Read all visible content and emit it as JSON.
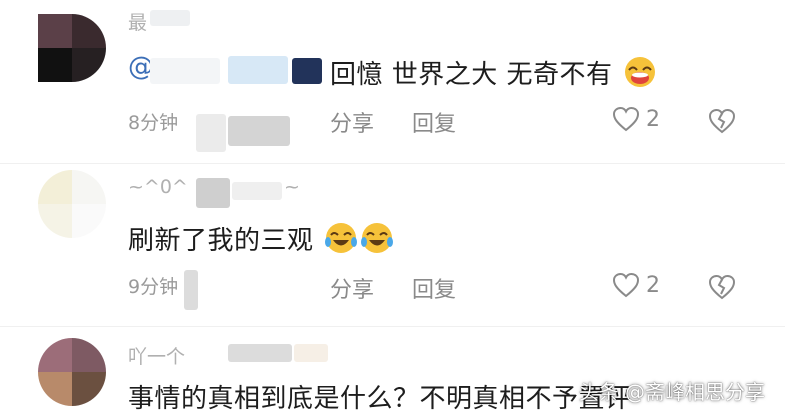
{
  "comments": [
    {
      "username": "最",
      "mention": "@",
      "text": "回憶 世界之大 无奇不有",
      "time": "8分钟",
      "share_label": "分享",
      "reply_label": "回复",
      "likes": "2",
      "avatar_colors": [
        "#5b4048",
        "#3a2a2e",
        "#111111",
        "#262022"
      ]
    },
    {
      "username": "~^0^",
      "username_suffix": "~",
      "text": "刷新了我的三观",
      "time": "9分钟",
      "share_label": "分享",
      "reply_label": "回复",
      "likes": "2",
      "avatar_colors": [
        "#f3efd8",
        "#f6f6f3",
        "#f5f3e6",
        "#fafafa"
      ]
    },
    {
      "username": "吖一个",
      "text": "事情的真相到底是什么？不明真相不予置评",
      "avatar_colors": [
        "#9c6d79",
        "#7e5a63",
        "#b88a6a",
        "#6b5040"
      ]
    }
  ],
  "watermark": "头条 @斋峰相思分享",
  "colors": {
    "mention": "#3c6fb7",
    "meta": "#9a9a9a",
    "emoji": "#f6c23a"
  }
}
